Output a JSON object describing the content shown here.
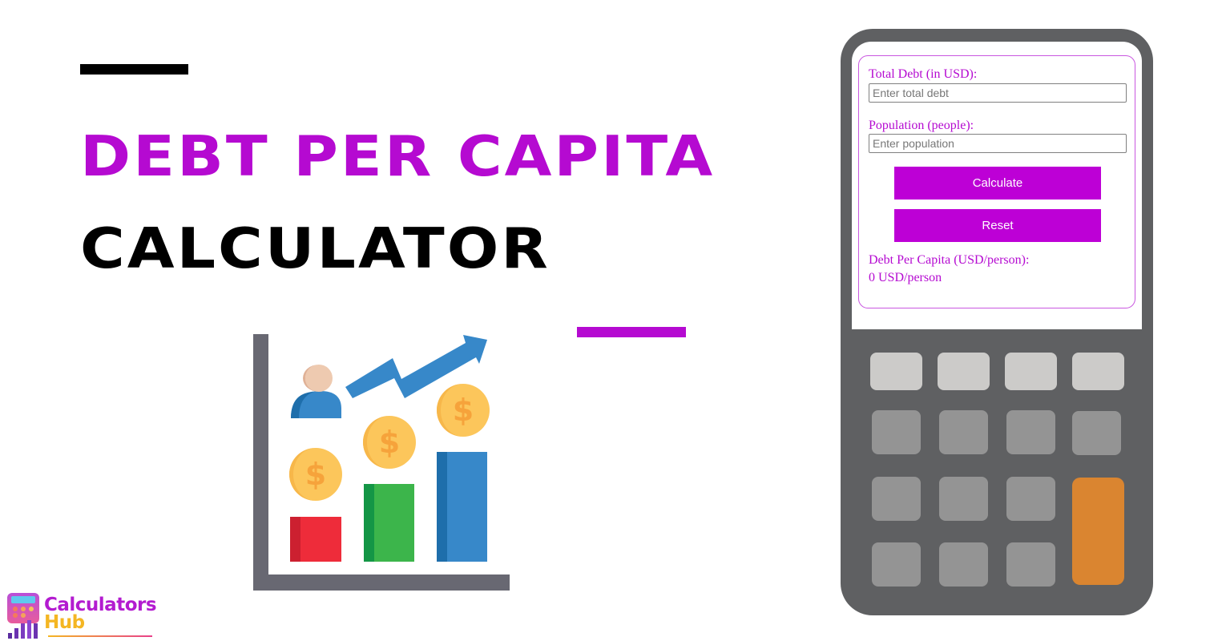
{
  "page": {
    "title_line1": "DEBT PER CAPITA",
    "title_line2": "CALCULATOR",
    "accent_color": "#b50ad1"
  },
  "calculator": {
    "total_debt": {
      "label": "Total Debt (in USD):",
      "placeholder": "Enter total debt",
      "value": ""
    },
    "population": {
      "label": "Population (people):",
      "placeholder": "Enter population",
      "value": ""
    },
    "calculate_label": "Calculate",
    "reset_label": "Reset",
    "result_label": "Debt Per Capita (USD/person):",
    "result_value": "0 USD/person",
    "keypad_rows": [
      [
        "light",
        "light",
        "light",
        "light"
      ],
      [
        "mid",
        "mid",
        "mid",
        "mid"
      ],
      [
        "mid",
        "mid",
        "mid",
        "orange"
      ],
      [
        "mid",
        "mid",
        "mid"
      ]
    ]
  },
  "illustration": {
    "icon": "debt-growth-chart-icon",
    "bars": [
      {
        "color": "#ee2c3a",
        "shade": "#cc2030"
      },
      {
        "color": "#3cb54b",
        "shade": "#149646"
      },
      {
        "color": "#3788c9",
        "shade": "#1e6eab"
      }
    ],
    "coin_symbol": "$"
  },
  "logo": {
    "line1": "Calculators",
    "line2": "Hub"
  }
}
